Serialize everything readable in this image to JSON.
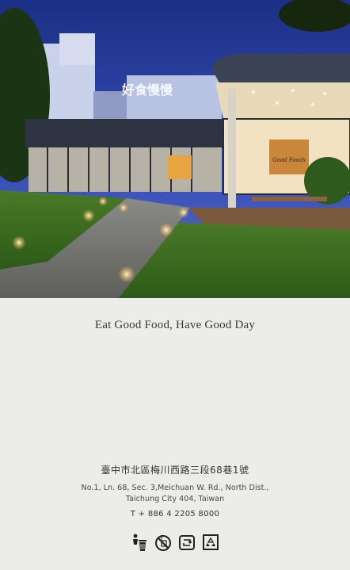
{
  "hero": {
    "alt": "Restaurant storefront at dusk",
    "sign_text": "好食慢慢",
    "window_script": "Good Foods"
  },
  "tagline": "Eat Good Food, Have Good Day",
  "address_zh": "臺中市北區梅川西路三段68巷1號",
  "address_en_line1": "No.1, Ln. 68, Sec. 3,Meichuan W. Rd., North Dist.,",
  "address_en_line2": "Taichung City 404, Taiwan",
  "phone": "T + 886 4 2205 8000",
  "icons": [
    "trash-can-person-icon",
    "no-disposables-icon",
    "reuse-container-icon",
    "recycle-box-icon"
  ],
  "colors": {
    "background": "#ececeb",
    "sky": "#2a3f9c",
    "text": "#333333"
  }
}
